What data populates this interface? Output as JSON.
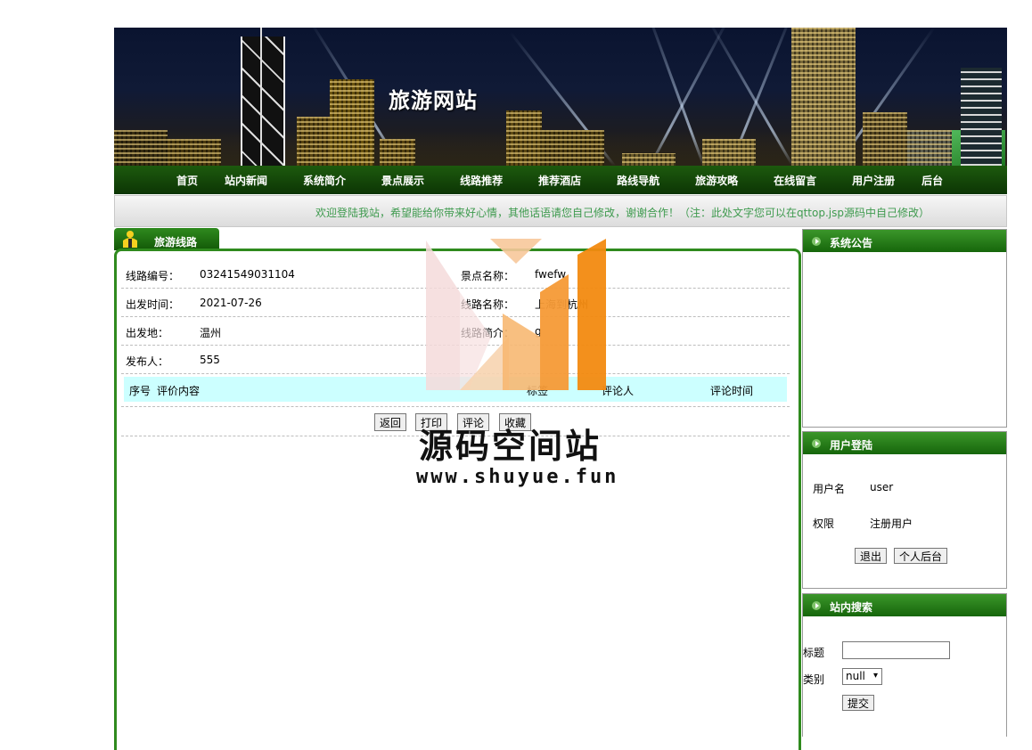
{
  "site": {
    "title": "旅游网站"
  },
  "nav": [
    "首页",
    "站内新闻",
    "系统简介",
    "景点展示",
    "线路推荐",
    "推荐酒店",
    "路线导航",
    "旅游攻略",
    "在线留言",
    "用户注册",
    "后台"
  ],
  "marquee": "欢迎登陆我站，希望能给你带来好心情，其他话语请您自己修改，谢谢合作！（注：此处文字您可以在qttop.jsp源码中自己修改）",
  "main": {
    "tab_label": "旅游线路",
    "rows": [
      {
        "l1": "线路编号：",
        "v1": "03241549031104",
        "l2": "景点名称：",
        "v2": "fwefw"
      },
      {
        "l1": "出发时间：",
        "v1": "2021-07-26",
        "l2": "线路名称：",
        "v2": "上海到杭州"
      },
      {
        "l1": "出发地：",
        "v1": "温州",
        "l2": "线路简介：",
        "v2": "g"
      },
      {
        "l1": "发布人：",
        "v1": "555"
      }
    ],
    "eval_headers": {
      "seq": "序号",
      "content": "评价内容",
      "label": "标签",
      "reviewer": "评论人",
      "time": "评论时间"
    },
    "buttons": {
      "back": "返回",
      "print": "打印",
      "comment": "评论",
      "favorite": "收藏"
    }
  },
  "sidebar": {
    "notice": {
      "title": "系统公告"
    },
    "login": {
      "title": "用户登陆",
      "username_label": "用户名",
      "username": "user",
      "role_label": "权限",
      "role": "注册用户",
      "logout": "退出",
      "personal": "个人后台"
    },
    "search": {
      "title": "站内搜索",
      "title_label": "标题",
      "title_value": "",
      "category_label": "类别",
      "category_value": "null",
      "submit": "提交"
    }
  },
  "watermark": {
    "name": "源码空间站",
    "url": "www.shuyue.fun"
  },
  "colors": {
    "nav_green": "#0c3504",
    "accent_green": "#2f8a1e",
    "marquee_text": "#3e9a4e",
    "eval_header_bg": "#ccffff"
  }
}
